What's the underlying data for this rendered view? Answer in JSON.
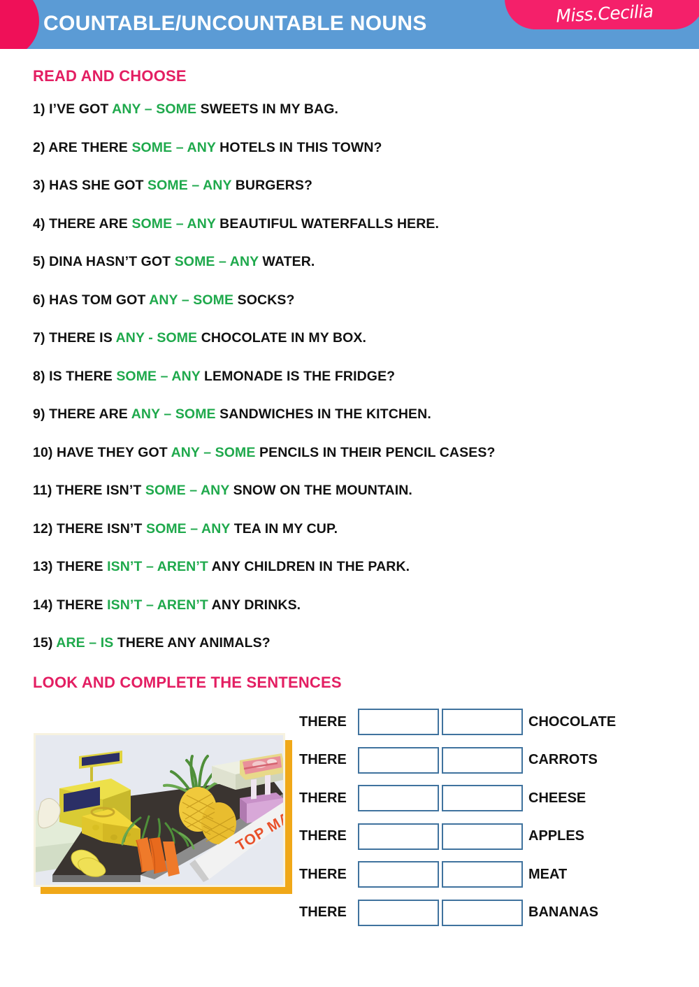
{
  "header": {
    "title": "COUNTABLE/UNCOUNTABLE NOUNS",
    "badge_text": "Miss.Cecilia",
    "bar_color": "#5b9bd5",
    "badge_color": "#f4206a",
    "title_color": "#ffffff"
  },
  "sections": {
    "read_and_choose": {
      "heading": "READ AND CHOOSE",
      "heading_color": "#e31e62",
      "choice_color": "#1fa94c",
      "items": [
        {
          "number": "1)",
          "before": "I’VE GOT ",
          "choice": "ANY – SOME",
          "after": " SWEETS IN MY BAG."
        },
        {
          "number": "2)",
          "before": "ARE THERE ",
          "choice": "SOME – ANY",
          "after": " HOTELS IN THIS TOWN?"
        },
        {
          "number": "3)",
          "before": "HAS SHE GOT ",
          "choice": "SOME – ANY",
          "after": " BURGERS?"
        },
        {
          "number": "4)",
          "before": "THERE ARE ",
          "choice": "SOME – ANY",
          "after": " BEAUTIFUL WATERFALLS HERE."
        },
        {
          "number": "5)",
          "before": "DINA HASN’T GOT ",
          "choice": "SOME – ANY",
          "after": " WATER."
        },
        {
          "number": "6)",
          "before": "HAS TOM GOT ",
          "choice": "ANY – SOME",
          "after": " SOCKS?"
        },
        {
          "number": "7)",
          "before": "THERE IS ",
          "choice": "ANY - SOME",
          "after": " CHOCOLATE IN MY BOX."
        },
        {
          "number": "8)",
          "before": "IS THERE ",
          "choice": "SOME – ANY",
          "after": " LEMONADE IS THE FRIDGE?"
        },
        {
          "number": "9)",
          "before": "THERE ARE ",
          "choice": "ANY – SOME",
          "after": " SANDWICHES IN THE KITCHEN."
        },
        {
          "number": "10)",
          "before": "HAVE THEY GOT ",
          "choice": "ANY – SOME",
          "after": " PENCILS IN THEIR PENCIL CASES?"
        },
        {
          "number": "11)",
          "before": "THERE ISN’T ",
          "choice": "SOME – ANY",
          "after": " SNOW ON THE MOUNTAIN."
        },
        {
          "number": "12)",
          "before": "THERE ISN’T ",
          "choice": "SOME – ANY",
          "after": " TEA IN MY CUP."
        },
        {
          "number": "13)",
          "before": "THERE ",
          "choice": "ISN’T – AREN’T",
          "after": " ANY CHILDREN IN THE PARK."
        },
        {
          "number": "14)",
          "before": "THERE ",
          "choice": "ISN’T – AREN’T",
          "after": " ANY DRINKS."
        },
        {
          "number": "15)",
          "before": "",
          "choice": "ARE – IS",
          "after": " THERE ANY ANIMALS?"
        }
      ]
    },
    "look_and_complete": {
      "heading": "LOOK AND COMPLETE THE SENTENCES",
      "heading_color": "#e31e62",
      "there_label": "THERE",
      "box_border_color": "#40739e",
      "rows": [
        {
          "there": "THERE",
          "box1": "",
          "box2": "",
          "word": "CHOCOLATE"
        },
        {
          "there": "THERE",
          "box1": "",
          "box2": "",
          "word": "CARROTS"
        },
        {
          "there": "THERE",
          "box1": "",
          "box2": "",
          "word": "CHEESE"
        },
        {
          "there": "THERE",
          "box1": "",
          "box2": "",
          "word": "APPLES"
        },
        {
          "there": "THERE",
          "box1": "",
          "box2": "",
          "word": "MEAT"
        },
        {
          "there": "THERE",
          "box1": "",
          "box2": "",
          "word": "BANANAS"
        }
      ],
      "picture": {
        "alt": "supermarket-checkout-illustration",
        "sign_text": "TOP MARK",
        "shadow_color": "#f0a818"
      }
    }
  }
}
